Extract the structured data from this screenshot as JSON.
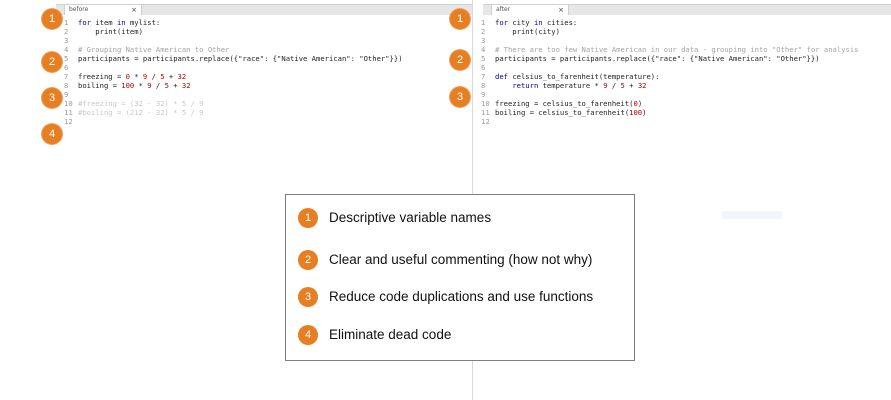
{
  "left_pane": {
    "tab": {
      "label": "before",
      "close": "×"
    },
    "lines": [
      {
        "n": "1",
        "segments": [
          {
            "t": "for ",
            "c": "kw"
          },
          {
            "t": "item ",
            "c": ""
          },
          {
            "t": "in ",
            "c": "kw"
          },
          {
            "t": "mylist:",
            "c": ""
          }
        ]
      },
      {
        "n": "2",
        "segments": [
          {
            "t": "    print(item)",
            "c": ""
          }
        ]
      },
      {
        "n": "3",
        "segments": []
      },
      {
        "n": "4",
        "segments": [
          {
            "t": "# Grouping Native American to Other",
            "c": "cm"
          }
        ]
      },
      {
        "n": "5",
        "segments": [
          {
            "t": "participants = participants.replace({\"race\": {\"Native American\": \"Other\"}})",
            "c": ""
          }
        ]
      },
      {
        "n": "6",
        "segments": []
      },
      {
        "n": "7",
        "segments": [
          {
            "t": "freezing = ",
            "c": ""
          },
          {
            "t": "0",
            "c": "num"
          },
          {
            "t": " * ",
            "c": ""
          },
          {
            "t": "9",
            "c": "num"
          },
          {
            "t": " / ",
            "c": ""
          },
          {
            "t": "5",
            "c": "num"
          },
          {
            "t": " + ",
            "c": ""
          },
          {
            "t": "32",
            "c": "num"
          }
        ]
      },
      {
        "n": "8",
        "segments": [
          {
            "t": "boiling = ",
            "c": ""
          },
          {
            "t": "100",
            "c": "num"
          },
          {
            "t": " * ",
            "c": ""
          },
          {
            "t": "9",
            "c": "num"
          },
          {
            "t": " / ",
            "c": ""
          },
          {
            "t": "5",
            "c": "num"
          },
          {
            "t": " + ",
            "c": ""
          },
          {
            "t": "32",
            "c": "num"
          }
        ]
      },
      {
        "n": "9",
        "segments": []
      },
      {
        "n": "10",
        "segments": [
          {
            "t": "#freezing = (32 - 32) * 5 / 9",
            "c": "faded"
          }
        ]
      },
      {
        "n": "11",
        "segments": [
          {
            "t": "#boiling = (212 - 32) * 5 / 9",
            "c": "faded"
          }
        ]
      },
      {
        "n": "12",
        "segments": []
      }
    ]
  },
  "right_pane": {
    "tab": {
      "label": "after",
      "close": "×"
    },
    "lines": [
      {
        "n": "1",
        "segments": [
          {
            "t": "for ",
            "c": "kw"
          },
          {
            "t": "city ",
            "c": ""
          },
          {
            "t": "in ",
            "c": "kw"
          },
          {
            "t": "cities:",
            "c": ""
          }
        ]
      },
      {
        "n": "2",
        "segments": [
          {
            "t": "    print(city)",
            "c": ""
          }
        ]
      },
      {
        "n": "3",
        "segments": []
      },
      {
        "n": "4",
        "segments": [
          {
            "t": "# There are too few Native American in our data - grouping into \"Other\" for analysis",
            "c": "cm"
          }
        ]
      },
      {
        "n": "5",
        "segments": [
          {
            "t": "participants = participants.replace({\"race\": {\"Native American\": \"Other\"}})",
            "c": ""
          }
        ]
      },
      {
        "n": "6",
        "segments": []
      },
      {
        "n": "7",
        "segments": [
          {
            "t": "def ",
            "c": "kw"
          },
          {
            "t": "celsius_to_farenheit(temperature):",
            "c": ""
          }
        ]
      },
      {
        "n": "8",
        "segments": [
          {
            "t": "    ",
            "c": ""
          },
          {
            "t": "return ",
            "c": "kw"
          },
          {
            "t": "temperature * ",
            "c": ""
          },
          {
            "t": "9",
            "c": "num"
          },
          {
            "t": " / ",
            "c": ""
          },
          {
            "t": "5",
            "c": "num"
          },
          {
            "t": " + ",
            "c": ""
          },
          {
            "t": "32",
            "c": "num"
          }
        ]
      },
      {
        "n": "9",
        "segments": []
      },
      {
        "n": "10",
        "segments": [
          {
            "t": "freezing = celsius_to_farenheit(",
            "c": ""
          },
          {
            "t": "0",
            "c": "num"
          },
          {
            "t": ")",
            "c": ""
          }
        ]
      },
      {
        "n": "11",
        "segments": [
          {
            "t": "boiling = celsius_to_farenheit(",
            "c": ""
          },
          {
            "t": "100",
            "c": "num"
          },
          {
            "t": ")",
            "c": ""
          }
        ]
      },
      {
        "n": "12",
        "segments": []
      }
    ]
  },
  "markers": [
    "1",
    "2",
    "3",
    "4"
  ],
  "legend": [
    {
      "num": "1",
      "text": "Descriptive variable names"
    },
    {
      "num": "2",
      "text": "Clear and useful commenting  (how not why)"
    },
    {
      "num": "3",
      "text": "Reduce code duplications and use functions"
    },
    {
      "num": "4",
      "text": "Eliminate dead code"
    }
  ],
  "colors": {
    "accent": "#e67e22",
    "keyword": "#0000a8",
    "comment": "#a3a3a3",
    "number": "#b00000"
  }
}
